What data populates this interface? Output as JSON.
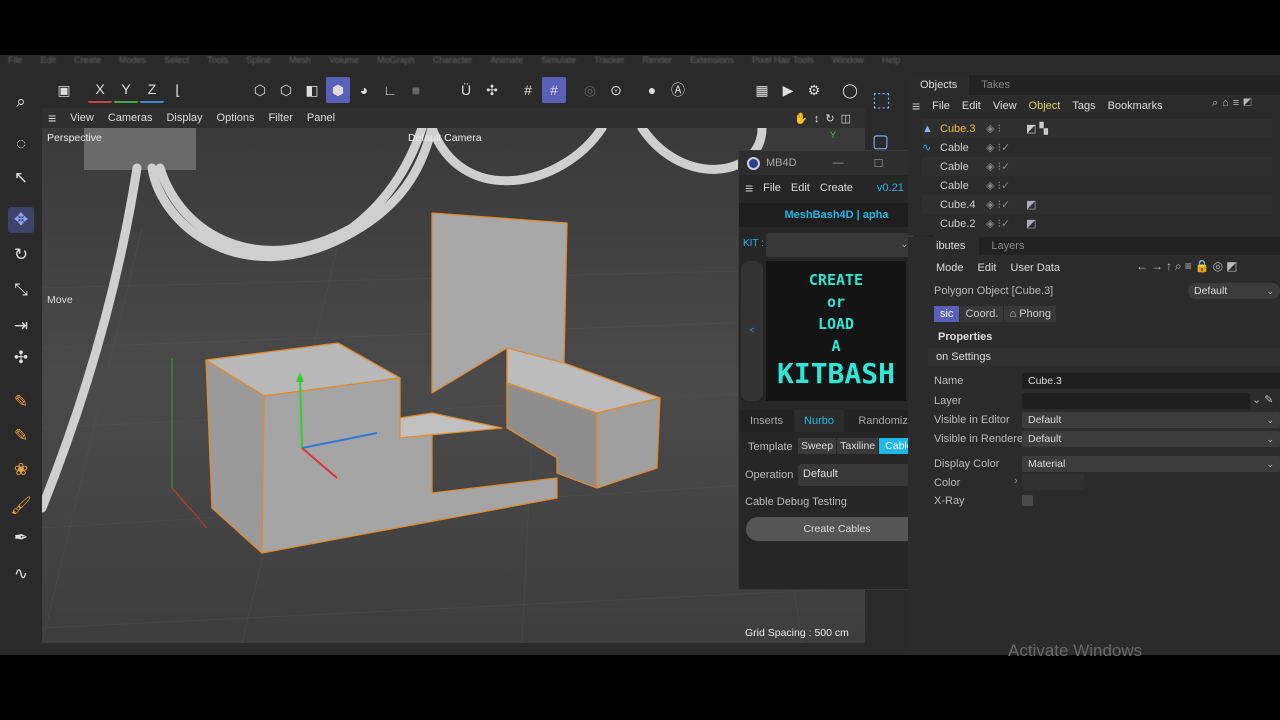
{
  "menubar": [
    "File",
    "Edit",
    "Create",
    "Modes",
    "Select",
    "Tools",
    "Spline",
    "Mesh",
    "Volume",
    "MoGraph",
    "Character",
    "Animate",
    "Simulate",
    "Tracker",
    "Render",
    "Extensions",
    "Pixel Hair Tools",
    "Window",
    "Help"
  ],
  "toolbar": {
    "x": "X",
    "y": "Y",
    "z": "Z"
  },
  "viewport": {
    "menu": [
      "View",
      "Cameras",
      "Display",
      "Options",
      "Filter",
      "Panel"
    ],
    "label": "Perspective",
    "camera": "Default Camera",
    "tool_label": "Move",
    "grid_spacing": "Grid Spacing : 500 cm",
    "axis_y": "Y"
  },
  "mb4d": {
    "title": "MB4D",
    "menu": [
      "File",
      "Edit",
      "Create"
    ],
    "version": "v0.21",
    "alert": "!",
    "subtitle": "MeshBash4D | apha",
    "kit_label": "KIT :",
    "kit_value": "",
    "banner": [
      "CREATE",
      "or",
      "LOAD",
      "A",
      "KITBASH"
    ],
    "prev": "<",
    "next": ">",
    "tabs": [
      "Inserts",
      "Nurbo",
      "Randomizer"
    ],
    "active_tab": "Nurbo",
    "template_label": "Template",
    "templates": [
      "Sweep",
      "Taxiline",
      "Cable"
    ],
    "active_template": "Cable",
    "operation_label": "Operation",
    "operation_value": "Default",
    "debug_label": "Cable Debug Testing",
    "create_button": "Create Cables"
  },
  "objects": {
    "tabs": [
      "Objects",
      "Takes"
    ],
    "menu": [
      "File",
      "Edit",
      "View",
      "Object",
      "Tags",
      "Bookmarks"
    ],
    "items": [
      {
        "name": "Cube.3",
        "selected": true
      },
      {
        "name": "Cable"
      },
      {
        "name": "Cable"
      },
      {
        "name": "Cable"
      },
      {
        "name": "Cube.4"
      },
      {
        "name": "Cube.2"
      }
    ]
  },
  "attributes": {
    "tabs": [
      "ibutes",
      "Layers"
    ],
    "menu": [
      "Mode",
      "Edit",
      "User Data"
    ],
    "object_title": "Polygon Object [Cube.3]",
    "preset": "Default",
    "subtabs": [
      "sic",
      "Coord.",
      "Phong"
    ],
    "section": "Properties",
    "subsection": "on Settings",
    "fields": [
      {
        "label": "Name",
        "value": "Cube.3"
      },
      {
        "label": "Layer",
        "value": ""
      },
      {
        "label": "Visible in Editor",
        "value": "Default"
      },
      {
        "label": "Visible in Renderer",
        "value": "Default"
      },
      {
        "label": "Display Color",
        "value": "Material"
      },
      {
        "label": "Color",
        "value": ""
      },
      {
        "label": "X-Ray",
        "value": ""
      }
    ]
  },
  "watermark": "Activate Windows",
  "colors": {
    "accent": "#5a5fb8",
    "cyan": "#1fb8e8",
    "kitbash": "#2ee6d6",
    "selection": "#e08a2c"
  }
}
